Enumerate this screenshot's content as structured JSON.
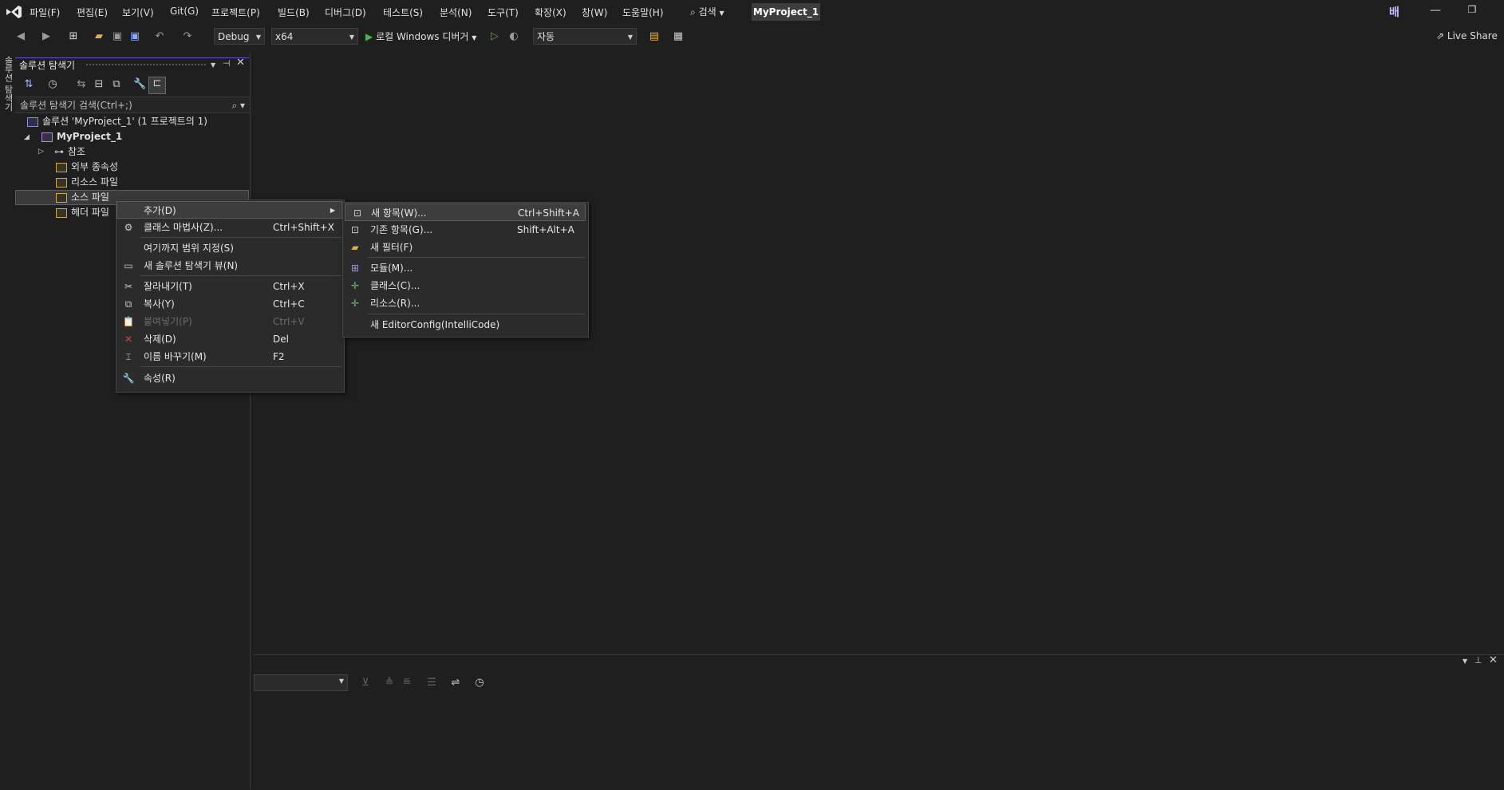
{
  "app": {
    "project_badge": "MyProject_1",
    "search_label": "검색",
    "live_share": "Live Share",
    "right_glyph": "배"
  },
  "menubar": {
    "items": [
      "파일(F)",
      "편집(E)",
      "보기(V)",
      "Git(G)",
      "프로젝트(P)",
      "빌드(B)",
      "디버그(D)",
      "테스트(S)",
      "분석(N)",
      "도구(T)",
      "확장(X)",
      "창(W)",
      "도움말(H)"
    ]
  },
  "toolbar": {
    "config": "Debug",
    "platform": "x64",
    "run_label": "로컬 Windows 디버거",
    "auto": "자동"
  },
  "vtab": {
    "label": "솔루션 탐색기"
  },
  "solution_explorer": {
    "title": "솔루션 탐색기",
    "search_placeholder": "솔루션 탐색기 검색(Ctrl+;)",
    "solution_node": "솔루션 'MyProject_1' (1 프로젝트의 1)",
    "project_node": "MyProject_1",
    "references": "참조",
    "external_deps": "외부 종속성",
    "resource_files": "리소스 파일",
    "source_files": "소스 파일",
    "header_files": "헤더 파일"
  },
  "context_menu": {
    "add": "추가(D)",
    "class_wizard": "클래스 마법사(Z)...",
    "class_wizard_sc": "Ctrl+Shift+X",
    "scope_here": "여기까지 범위 지정(S)",
    "new_view": "새 솔루션 탐색기 뷰(N)",
    "cut": "잘라내기(T)",
    "cut_sc": "Ctrl+X",
    "copy": "복사(Y)",
    "copy_sc": "Ctrl+C",
    "paste": "붙여넣기(P)",
    "paste_sc": "Ctrl+V",
    "delete": "삭제(D)",
    "delete_sc": "Del",
    "rename": "이름 바꾸기(M)",
    "rename_sc": "F2",
    "properties": "속성(R)"
  },
  "submenu": {
    "new_item": "새 항목(W)...",
    "new_item_sc": "Ctrl+Shift+A",
    "existing_item": "기존 항목(G)...",
    "existing_item_sc": "Shift+Alt+A",
    "new_filter": "새 필터(F)",
    "module": "모듈(M)...",
    "class": "클래스(C)...",
    "resource": "리소스(R)...",
    "editorconfig": "새 EditorConfig(IntelliCode)"
  },
  "colors": {
    "accent": "#6c4fd1",
    "background": "#1f1f1f",
    "menu_bg": "#2b2b2b",
    "run_green": "#4fb04f",
    "delete_red": "#d04040"
  }
}
